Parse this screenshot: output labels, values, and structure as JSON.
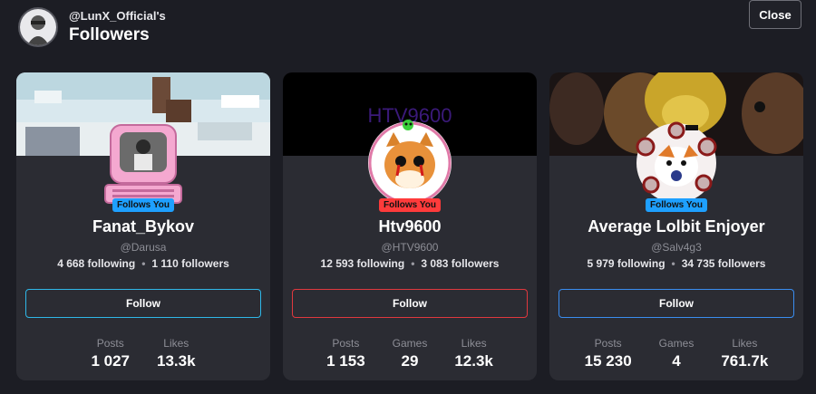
{
  "header": {
    "owner_handle": "@LunX_Official's",
    "title": "Followers",
    "close_label": "Close"
  },
  "cards": [
    {
      "display_name": "Fanat_Bykov",
      "username": "@Darusa",
      "following": "4 668 following",
      "followers": "1 110 followers",
      "follows_you": "Follows You",
      "follow_label": "Follow",
      "accent": "#2fb7e8",
      "badge_bg": "#1ea0ff",
      "stats": [
        {
          "label": "Posts",
          "value": "1 027"
        },
        {
          "label": "Likes",
          "value": "13.3k"
        }
      ]
    },
    {
      "display_name": "Htv9600",
      "username": "@HTV9600",
      "following": "12 593 following",
      "followers": "3 083 followers",
      "follows_you": "Follows You",
      "follow_label": "Follow",
      "accent": "#e0383e",
      "badge_bg": "#ff3b3b",
      "banner_text": "HTV9600",
      "stats": [
        {
          "label": "Posts",
          "value": "1 153"
        },
        {
          "label": "Games",
          "value": "29"
        },
        {
          "label": "Likes",
          "value": "12.3k"
        }
      ]
    },
    {
      "display_name": "Average Lolbit Enjoyer",
      "username": "@Salv4g3",
      "following": "5 979 following",
      "followers": "34 735 followers",
      "follows_you": "Follows You",
      "follow_label": "Follow",
      "accent": "#3a8df0",
      "badge_bg": "#1ea0ff",
      "stats": [
        {
          "label": "Posts",
          "value": "15 230"
        },
        {
          "label": "Games",
          "value": "4"
        },
        {
          "label": "Likes",
          "value": "761.7k"
        }
      ]
    }
  ]
}
